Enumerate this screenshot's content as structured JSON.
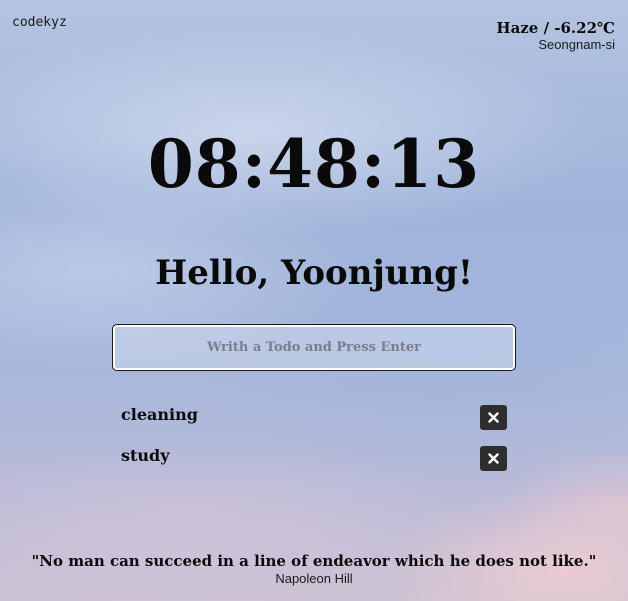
{
  "brand": "codekyz",
  "weather": {
    "summary": "Haze / -6.22℃",
    "city": "Seongnam-si"
  },
  "clock": "08:48:13",
  "greeting": "Hello, Yoonjung!",
  "todo_input": {
    "placeholder": "Writh a Todo and Press Enter",
    "value": ""
  },
  "todos": [
    {
      "text": "cleaning",
      "delete_icon": "close-icon"
    },
    {
      "text": "study",
      "delete_icon": "close-icon"
    }
  ],
  "quote": {
    "text": "\"No man can succeed in a line of endeavor which he does not like.\"",
    "author": "Napoleon Hill"
  },
  "colors": {
    "text": "#0a0a0a",
    "button_bg": "#2e2e2e",
    "input_border": "#ffffff"
  }
}
